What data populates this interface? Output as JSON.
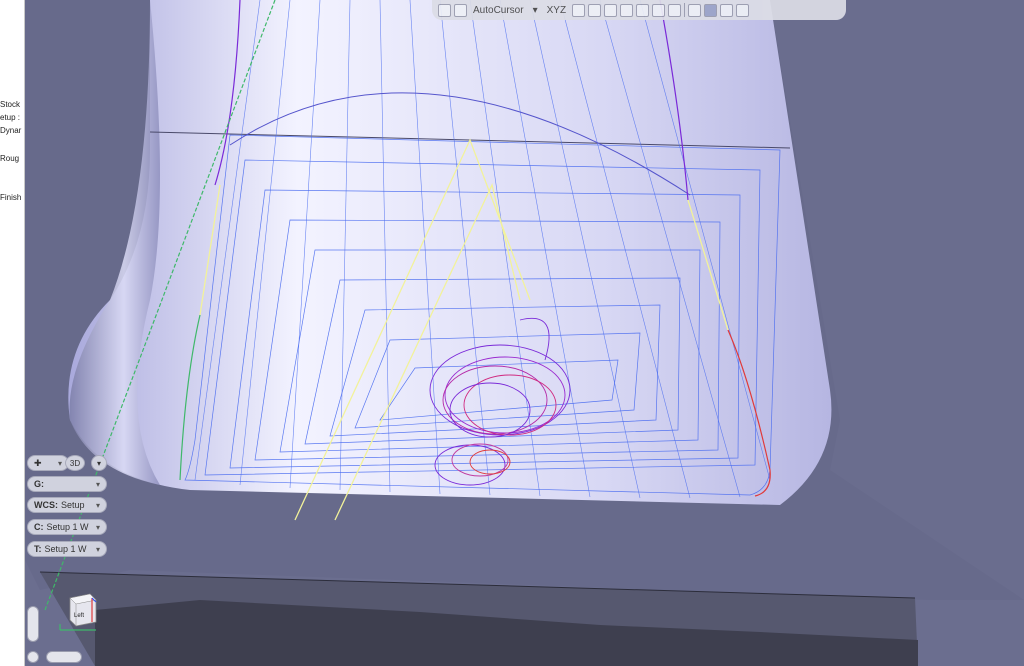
{
  "tree": {
    "items": [
      {
        "label": "Stock"
      },
      {
        "label": "etup :"
      },
      {
        "label": "Dynar"
      },
      {
        "label": "Roug"
      },
      {
        "label": "Finish"
      }
    ]
  },
  "toolbar": {
    "autocursor_label": "AutoCursor",
    "xyz_label": "XYZ"
  },
  "view_controls": {
    "mode_3d": "3D",
    "g_label": "G:",
    "wcs_label": "WCS:",
    "wcs_value": "Setup",
    "c_label": "C:",
    "c_value": "Setup 1 W",
    "t_label": "T:",
    "t_value": "Setup 1 W"
  },
  "viewcube": {
    "face_label": "Left"
  },
  "colors": {
    "background": "#6b6e8f",
    "part_surface": "#c9c9ee",
    "toolpath_blue": "#4a6cf0",
    "toolpath_yellow": "#f2f29a",
    "toolpath_red": "#e03a3a",
    "toolpath_purple": "#7a2ad8",
    "toolpath_green": "#3fb86a"
  },
  "icons": [
    "save-icon",
    "select-icon",
    "down-chevron-icon",
    "xyz-icon",
    "gear-icon",
    "pointer-icon",
    "copy-icon",
    "view-icon",
    "fit-icon",
    "display-icon",
    "grid-icon",
    "orbit-icon",
    "zoom-icon"
  ]
}
